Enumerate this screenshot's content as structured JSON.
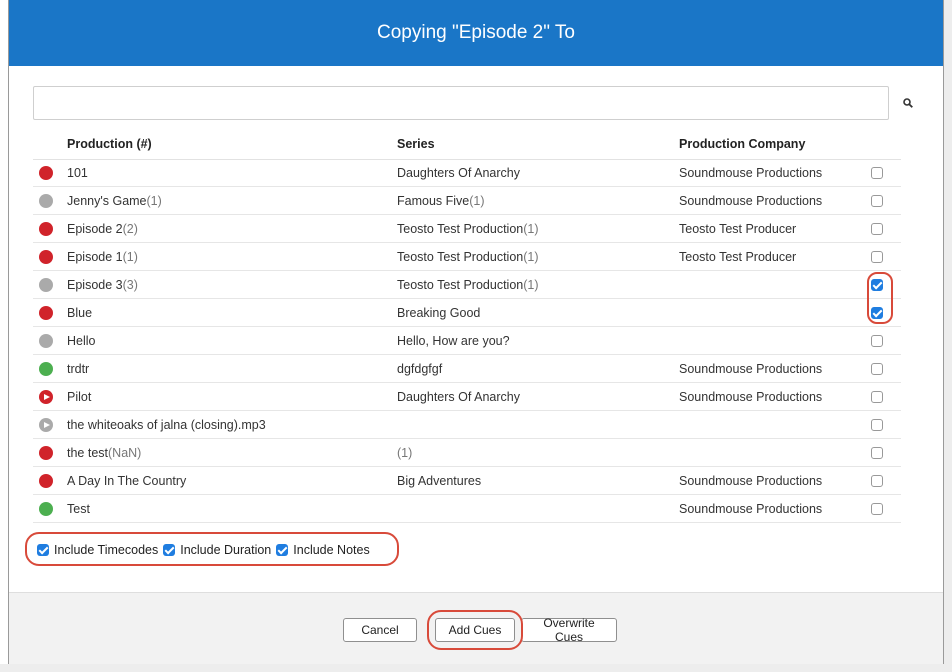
{
  "dialog": {
    "title": "Copying \"Episode 2\" To"
  },
  "search": {
    "value": "",
    "placeholder": ""
  },
  "table": {
    "headers": {
      "production": "Production (#)",
      "series": "Series",
      "company": "Production Company"
    },
    "rows": [
      {
        "production": "101",
        "production_count": "",
        "series": "Daughters Of Anarchy",
        "series_count": "",
        "company": "Soundmouse Productions",
        "status": "red",
        "checked": false
      },
      {
        "production": "Jenny's Game",
        "production_count": "(1)",
        "series": "Famous Five",
        "series_count": "(1)",
        "company": "Soundmouse Productions",
        "status": "gray",
        "checked": false
      },
      {
        "production": "Episode 2",
        "production_count": "(2)",
        "series": "Teosto Test Production",
        "series_count": "(1)",
        "company": "Teosto Test Producer",
        "status": "red",
        "checked": false
      },
      {
        "production": "Episode 1",
        "production_count": "(1)",
        "series": "Teosto Test Production",
        "series_count": "(1)",
        "company": "Teosto Test Producer",
        "status": "red",
        "checked": false
      },
      {
        "production": "Episode 3",
        "production_count": "(3)",
        "series": "Teosto Test Production",
        "series_count": "(1)",
        "company": "",
        "status": "gray",
        "checked": true
      },
      {
        "production": "Blue",
        "production_count": "",
        "series": "Breaking Good",
        "series_count": "",
        "company": "",
        "status": "red",
        "checked": true
      },
      {
        "production": "Hello",
        "production_count": "",
        "series": "Hello, How are you?",
        "series_count": "",
        "company": "",
        "status": "gray",
        "checked": false
      },
      {
        "production": "trdtr",
        "production_count": "",
        "series": "dgfdgfgf",
        "series_count": "",
        "company": "Soundmouse Productions",
        "status": "green",
        "checked": false
      },
      {
        "production": "Pilot",
        "production_count": "",
        "series": "Daughters Of Anarchy",
        "series_count": "",
        "company": "Soundmouse Productions",
        "status": "red-play",
        "checked": false
      },
      {
        "production": "the whiteoaks of jalna (closing).mp3",
        "production_count": "",
        "series": "",
        "series_count": "",
        "company": "",
        "status": "gray-play",
        "checked": false
      },
      {
        "production": "the test",
        "production_count": "(NaN)",
        "series": "",
        "series_count": "(1)",
        "company": "",
        "status": "red",
        "checked": false
      },
      {
        "production": "A Day In The Country",
        "production_count": "",
        "series": "Big Adventures",
        "series_count": "",
        "company": "Soundmouse Productions",
        "status": "red",
        "checked": false
      },
      {
        "production": "Test",
        "production_count": "",
        "series": "",
        "series_count": "",
        "company": "Soundmouse Productions",
        "status": "green",
        "checked": false
      },
      {
        "production": "",
        "production_count": "",
        "series": "",
        "series_count": "",
        "company": "",
        "status": "red",
        "checked": false
      }
    ]
  },
  "options": {
    "timecodes": {
      "label": "Include Timecodes",
      "checked": true
    },
    "duration": {
      "label": "Include Duration",
      "checked": true
    },
    "notes": {
      "label": "Include Notes",
      "checked": true
    }
  },
  "buttons": {
    "cancel": "Cancel",
    "add_cues": "Add Cues",
    "overwrite_cues": "Overwrite Cues"
  },
  "colors": {
    "header": "#1a76c7",
    "status_red": "#d0232a",
    "status_gray": "#aaaaaa",
    "status_green": "#4caf50",
    "checkbox_on": "#1f7de0",
    "highlight": "#d84a3a"
  }
}
